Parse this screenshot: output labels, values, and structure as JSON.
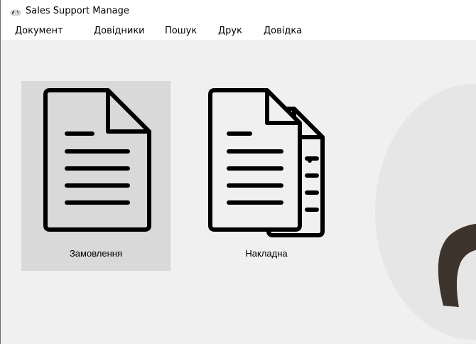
{
  "window": {
    "title": "Sales Support Manage"
  },
  "menu": {
    "items": [
      {
        "label": "Документ"
      },
      {
        "label": "Довідники"
      },
      {
        "label": "Пошук"
      },
      {
        "label": "Друк"
      },
      {
        "label": "Довідка"
      }
    ]
  },
  "tiles": [
    {
      "label": "Замовлення",
      "icon": "document-icon",
      "selected": true
    },
    {
      "label": "Накладна",
      "icon": "documents-copy-icon",
      "selected": false
    }
  ],
  "colors": {
    "window_bg": "#f0f0f0",
    "titlebar_bg": "#ffffff",
    "selected_tile_bg": "#d9d9d9",
    "logo_brown": "#3d332d",
    "blob_gray": "#e6e6e6"
  }
}
